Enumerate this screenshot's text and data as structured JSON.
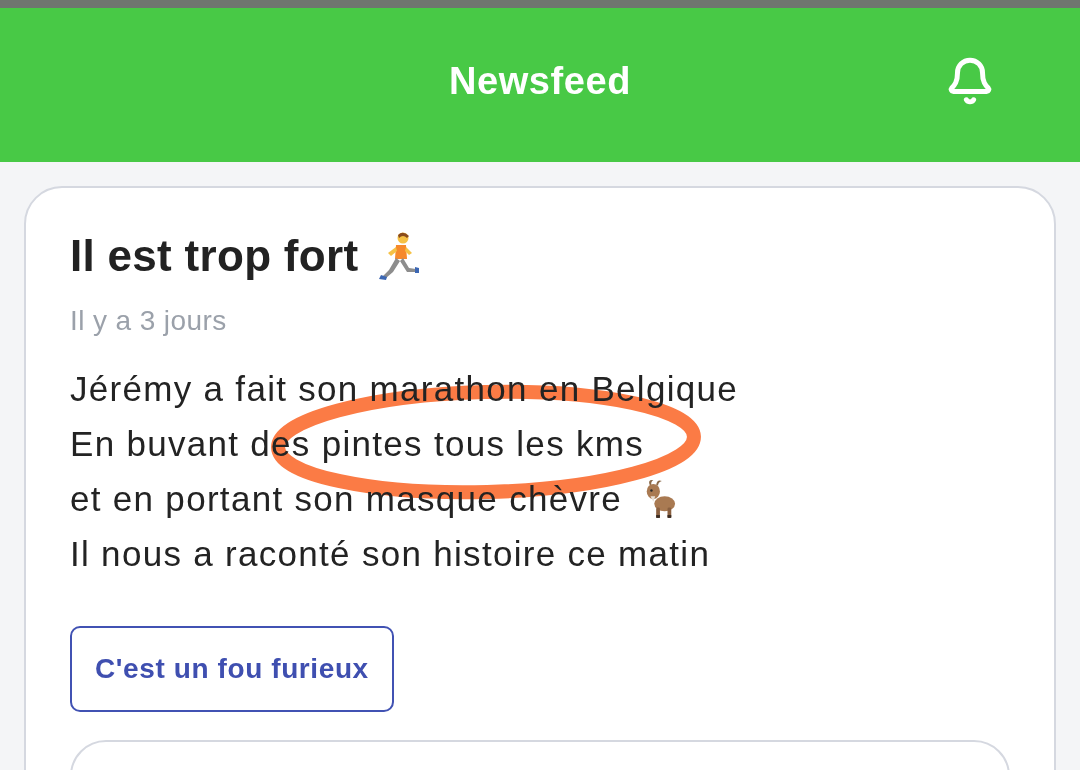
{
  "header": {
    "title": "Newsfeed"
  },
  "posts": [
    {
      "title": "Il est trop fort",
      "time": "Il y a 3 jours",
      "lines": [
        "Jérémy a fait son marathon en Belgique",
        "En buvant des pintes tous les kms",
        "et en portant son masque chèvre",
        "Il nous a raconté son histoire ce matin"
      ],
      "button": "C'est un fou furieux"
    }
  ]
}
